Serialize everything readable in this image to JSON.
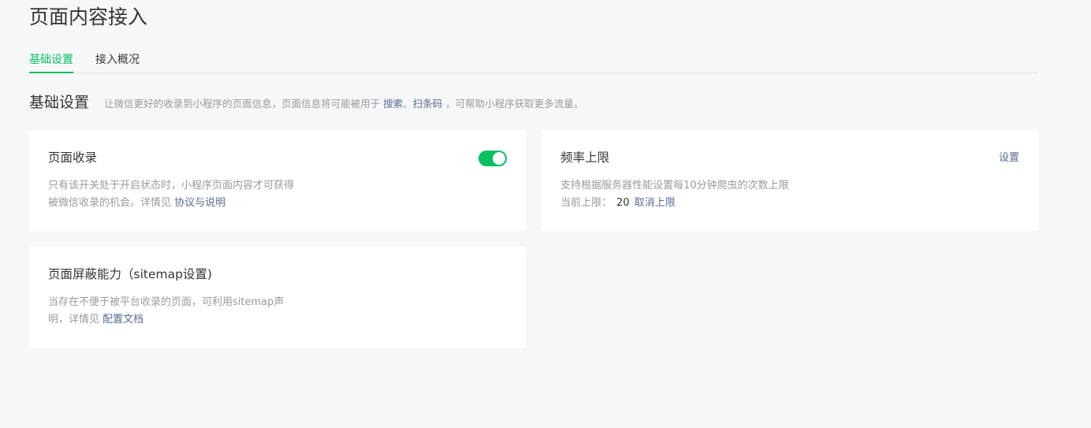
{
  "page": {
    "title": "页面内容接入"
  },
  "tabs": [
    {
      "label": "基础设置",
      "active": true
    },
    {
      "label": "接入概况",
      "active": false
    }
  ],
  "section": {
    "title": "基础设置",
    "desc_prefix": "让微信更好的收录到小程序的页面信息，页面信息将可能被用于",
    "link_search": "搜索",
    "sep": "、",
    "link_scan": "扫条码",
    "desc_suffix": "，可帮助小程序获取更多流量。"
  },
  "cards": {
    "page_index": {
      "title": "页面收录",
      "toggle_on": true,
      "desc_line1": "只有该开关处于开启状态时，小程序页面内容才可获得",
      "desc_line2": "被微信收录的机会。详情见",
      "link": "协议与说明"
    },
    "freq_limit": {
      "title": "频率上限",
      "action": "设置",
      "desc_line1": "支持根据服务器性能设置每10分钟爬虫的次数上限",
      "current_label": "当前上限：",
      "current_value": "20",
      "link": "取消上限"
    },
    "sitemap": {
      "title": "页面屏蔽能力（sitemap设置)",
      "desc_line1": "当存在不便于被平台收录的页面，可利用sitemap声",
      "desc_line2": "明，详情见",
      "link": "配置文档"
    }
  },
  "colors": {
    "accent": "#07c160",
    "link": "#576b95",
    "muted": "#9a9a9a",
    "background": "#f6f7f9"
  }
}
